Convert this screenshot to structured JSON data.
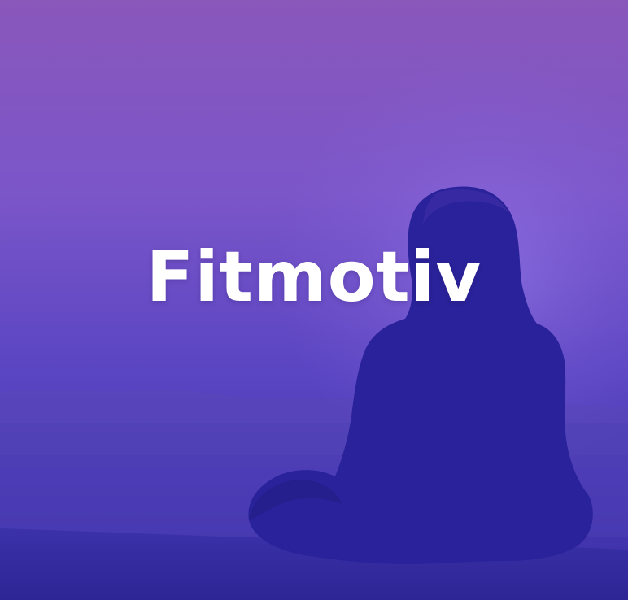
{
  "splash": {
    "app_name": "Fitmotiv",
    "image": "woman-meditating-silhouette"
  },
  "colors": {
    "gradient_top": "#8a57bb",
    "gradient_mid": "#7b56c9",
    "gradient_bottom": "#3a2ea6",
    "silhouette": "#2a229a",
    "title_text": "#ffffff"
  }
}
